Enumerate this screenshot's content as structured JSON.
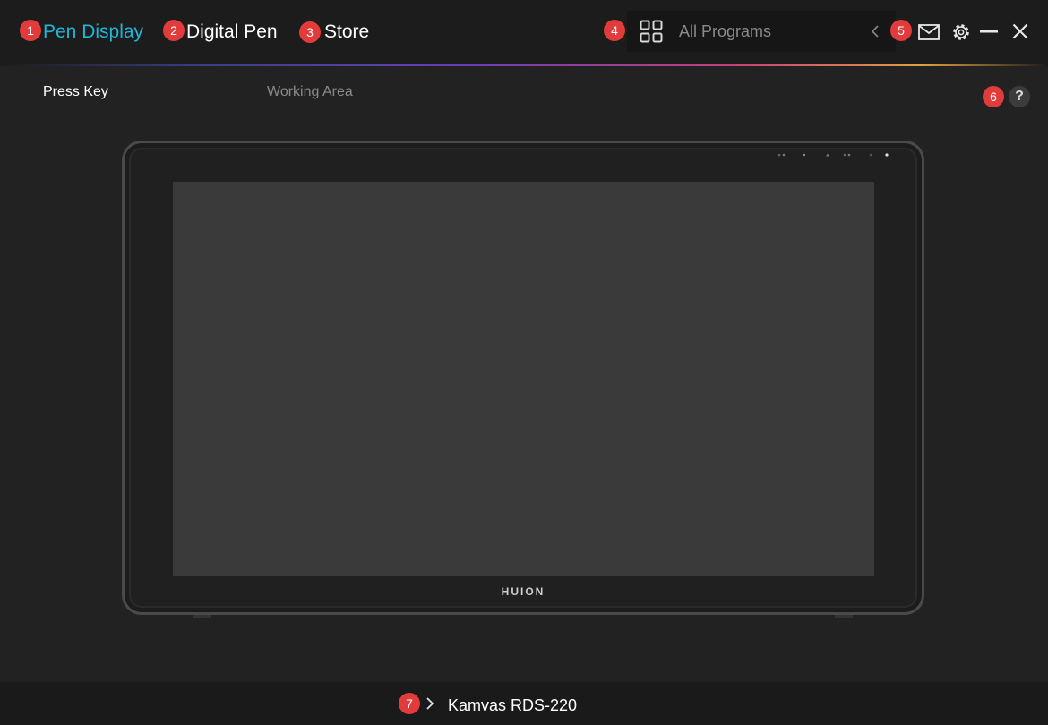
{
  "header": {
    "tabs": [
      {
        "label": "Pen Display",
        "badge": "1",
        "active": true
      },
      {
        "label": "Digital Pen",
        "badge": "2",
        "active": false
      },
      {
        "label": "Store",
        "badge": "3",
        "active": false
      }
    ],
    "programs": {
      "badge": "4",
      "label": "All Programs",
      "icon": "grid-icon"
    },
    "controls_badge": "5",
    "icons": [
      "chevron-left-icon",
      "mail-icon",
      "gear-icon",
      "minimize-icon",
      "close-icon"
    ]
  },
  "subtabs": [
    {
      "label": "Press Key",
      "active": true
    },
    {
      "label": "Working Area",
      "active": false
    }
  ],
  "help": {
    "badge": "6",
    "label": "?"
  },
  "device_preview": {
    "brand": "HUION"
  },
  "footer": {
    "badge": "7",
    "device_name": "Kamvas RDS-220",
    "icon": "chevron-right-icon"
  },
  "colors": {
    "accent": "#1fb6d8",
    "badge": "#e23b3b",
    "background": "#222222"
  }
}
